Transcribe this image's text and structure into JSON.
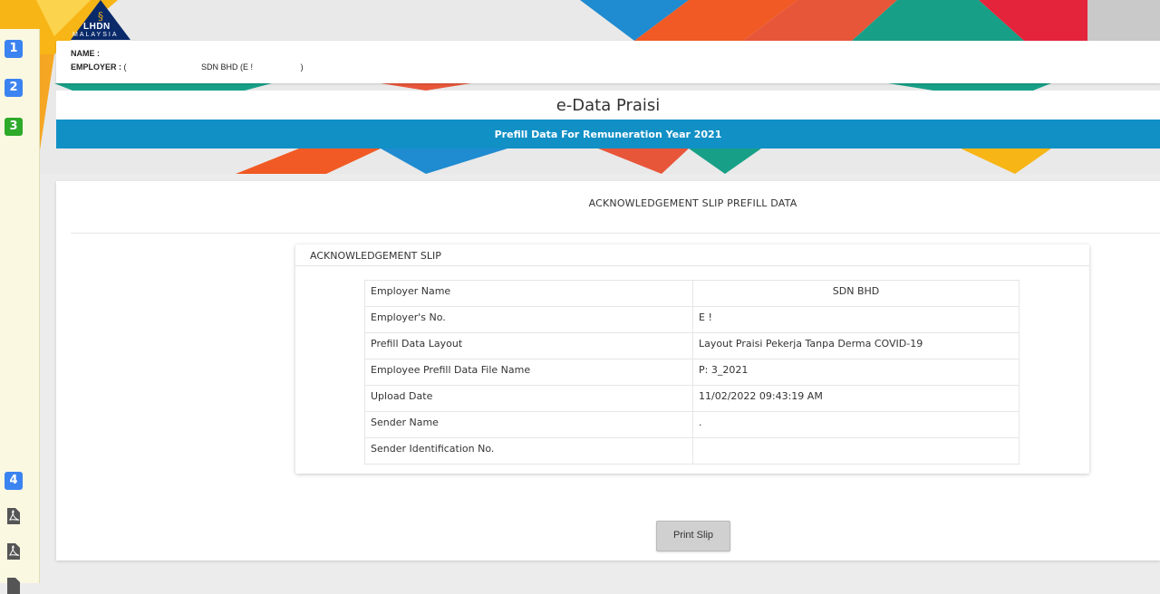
{
  "logo": {
    "name": "LHDN",
    "sub": "MALAYSIA"
  },
  "steps": [
    {
      "label": "1",
      "color": "#3b83f0"
    },
    {
      "label": "2",
      "color": "#3b83f0"
    },
    {
      "label": "3",
      "color": "#2eaa2a"
    },
    {
      "label": "4",
      "color": "#3b83f0"
    }
  ],
  "side_icons": [
    "pdf-icon",
    "pdf-icon",
    "document-icon"
  ],
  "header": {
    "name_label": "NAME :",
    "name_value": "",
    "employer_label": "EMPLOYER :",
    "employer_prefix": "(",
    "employer_value": "SDN BHD (E !",
    "employer_suffix": ")"
  },
  "title": "e-Data Praisi",
  "subtitle": "Prefill Data For Remuneration Year 2021",
  "accent_color": "#1190c6",
  "main": {
    "heading": "ACKNOWLEDGEMENT SLIP PREFILL DATA",
    "slip_title": "ACKNOWLEDGEMENT SLIP",
    "rows": [
      {
        "label": "Employer Name",
        "value": "SDN BHD",
        "center": true
      },
      {
        "label": "Employer's No.",
        "value": "E !"
      },
      {
        "label": "Prefill Data Layout",
        "value": "Layout Praisi Pekerja Tanpa Derma COVID-19"
      },
      {
        "label": "Employee Prefill Data File Name",
        "value": "P:                  3_2021"
      },
      {
        "label": "Upload Date",
        "value": "11/02/2022 09:43:19 AM"
      },
      {
        "label": "Sender Name",
        "value": "                              ."
      },
      {
        "label": "Sender Identification No.",
        "value": ""
      }
    ],
    "print_label": "Print Slip"
  }
}
